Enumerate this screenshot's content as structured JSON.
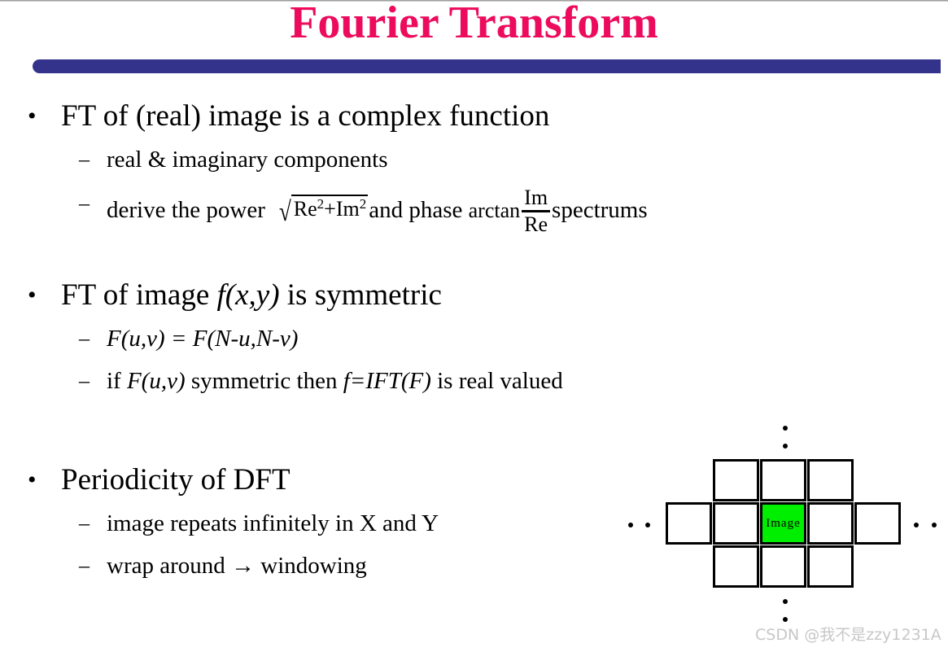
{
  "slide": {
    "title": "Fourier Transform",
    "title_color": "#EC0B5C",
    "accent_bar_color": "#33338C",
    "background_color": "#FFFFFF",
    "text_color": "#000000"
  },
  "bullets": [
    {
      "marker": "•",
      "text": "FT of (real) image is a complex function",
      "sub": [
        {
          "marker": "–",
          "text": "real & imaginary components"
        },
        {
          "marker": "–",
          "prefix": "derive the power",
          "sqrt_radical": "√",
          "sqrt_base1": "Re",
          "sqrt_exp1": "2",
          "sqrt_plus": "+",
          "sqrt_base2": "Im",
          "sqrt_exp2": "2",
          "middle": "and phase",
          "arctan": "arctan",
          "frac_num": "Im",
          "frac_den": "Re",
          "suffix": "spectrums"
        }
      ]
    },
    {
      "marker": "•",
      "text_pre": "FT of image ",
      "text_it": "f(x,y)",
      "text_post": " is symmetric",
      "sub": [
        {
          "marker": "–",
          "it_a": "F(u,v)",
          "op": " = ",
          "it_b": "F(N-u,N-v)"
        },
        {
          "marker": "–",
          "pre": "if ",
          "it_a": "F(u,v)",
          "mid": " symmetric then ",
          "it_b": "f=IFT(F)",
          "post": " is real valued"
        }
      ]
    },
    {
      "marker": "•",
      "text": "Periodicity of DFT",
      "sub": [
        {
          "marker": "–",
          "text": "image repeats infinitely in X and Y"
        },
        {
          "marker": "–",
          "text": "wrap around → windowing"
        }
      ]
    }
  ],
  "diagram": {
    "center_label": "Image",
    "center_color": "#00EE00",
    "border_color": "#000000",
    "ellipsis_dot": "•",
    "columns": 5,
    "rows": 3,
    "filled_pattern": [
      [
        false,
        true,
        true,
        true,
        false
      ],
      [
        true,
        true,
        true,
        true,
        true
      ],
      [
        false,
        true,
        true,
        true,
        false
      ]
    ]
  },
  "watermark": {
    "text": "CSDN @我不是zzy1231A",
    "color": "#C7C7C7"
  }
}
